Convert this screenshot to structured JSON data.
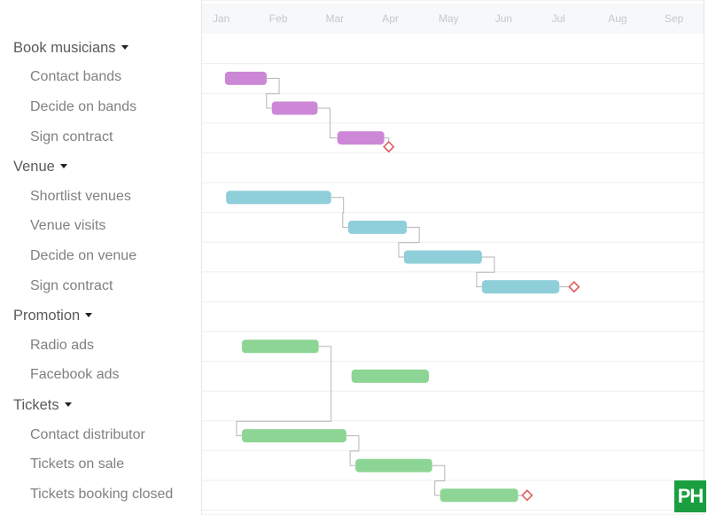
{
  "chart_data": {
    "type": "gantt",
    "title": "",
    "time_axis": {
      "unit": "month",
      "tick_labels": [
        "Jan",
        "Feb",
        "Mar",
        "Apr",
        "May",
        "Jun",
        "Jul",
        "Aug",
        "Sep"
      ]
    },
    "colors": {
      "Book musicians": "#cc88d6",
      "Venue": "#8ecfda",
      "Promotion": "#8dd594",
      "Tickets": "#8dd594",
      "milestone": "#e05a5a",
      "dependency_line": "#b5b5b5",
      "header_bg": "#f6f8fa",
      "grid_line": "#eeeeee"
    },
    "groups": [
      {
        "name": "Book musicians",
        "tasks": [
          {
            "name": "Contact bands",
            "start": 0.28,
            "end": 1.02
          },
          {
            "name": "Decide on bands",
            "start": 1.11,
            "end": 1.92
          },
          {
            "name": "Sign contract",
            "start": 2.27,
            "end": 3.1,
            "milestone": 3.18
          }
        ]
      },
      {
        "name": "Venue",
        "tasks": [
          {
            "name": "Shortlist venues",
            "start": 0.3,
            "end": 2.16
          },
          {
            "name": "Venue visits",
            "start": 2.46,
            "end": 3.5
          },
          {
            "name": "Decide on venue",
            "start": 3.45,
            "end": 4.83
          },
          {
            "name": "Sign contract",
            "start": 4.83,
            "end": 6.2,
            "milestone": 6.46
          }
        ]
      },
      {
        "name": "Promotion",
        "tasks": [
          {
            "name": "Radio ads",
            "start": 0.58,
            "end": 1.94
          },
          {
            "name": "Facebook ads",
            "start": 2.52,
            "end": 3.89
          }
        ]
      },
      {
        "name": "Tickets",
        "tasks": [
          {
            "name": "Contact distributor",
            "start": 0.58,
            "end": 2.43
          },
          {
            "name": "Tickets on sale",
            "start": 2.59,
            "end": 3.95
          },
          {
            "name": "Tickets booking closed",
            "start": 4.09,
            "end": 5.47,
            "milestone": 5.63
          }
        ]
      }
    ],
    "dependencies": [
      [
        "Book musicians/0",
        "Book musicians/1"
      ],
      [
        "Book musicians/1",
        "Book musicians/2"
      ],
      [
        "Book musicians/2",
        "milestone"
      ],
      [
        "Venue/0",
        "Venue/1"
      ],
      [
        "Venue/1",
        "Venue/2"
      ],
      [
        "Venue/2",
        "Venue/3"
      ],
      [
        "Venue/3",
        "milestone"
      ],
      [
        "Promotion/0",
        "Tickets/0"
      ],
      [
        "Tickets/0",
        "Tickets/1"
      ],
      [
        "Tickets/1",
        "Tickets/2"
      ],
      [
        "Tickets/2",
        "milestone"
      ]
    ]
  },
  "badge": {
    "text": "PH",
    "color": "#1a9e3f"
  }
}
